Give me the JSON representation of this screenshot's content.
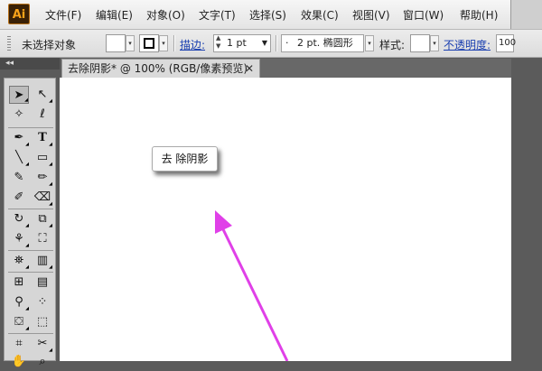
{
  "app": {
    "logo_text": "Ai"
  },
  "menu": [
    "文件(F)",
    "编辑(E)",
    "对象(O)",
    "文字(T)",
    "选择(S)",
    "效果(C)",
    "视图(V)",
    "窗口(W)",
    "帮助(H)"
  ],
  "control_bar": {
    "selection_label": "未选择对象",
    "stroke_link": "描边:",
    "stroke_weight": "1 pt",
    "brush_dot": "·",
    "brush_value": "2 pt. 椭圆形",
    "style_label": "样式:",
    "opacity_link": "不透明度:",
    "opacity_value": "100"
  },
  "tools_panel": {
    "collapse_glyph": "◂◂"
  },
  "document": {
    "tab_title": "去除阴影* @ 100% (RGB/像素预览)",
    "close_glyph": "✕",
    "callout_text": "去 除阴影"
  },
  "colors": {
    "arrow": "#e040e8",
    "logo_bg": "#3a2106",
    "logo_text": "#f9a31a",
    "link": "#1a3fb0"
  }
}
